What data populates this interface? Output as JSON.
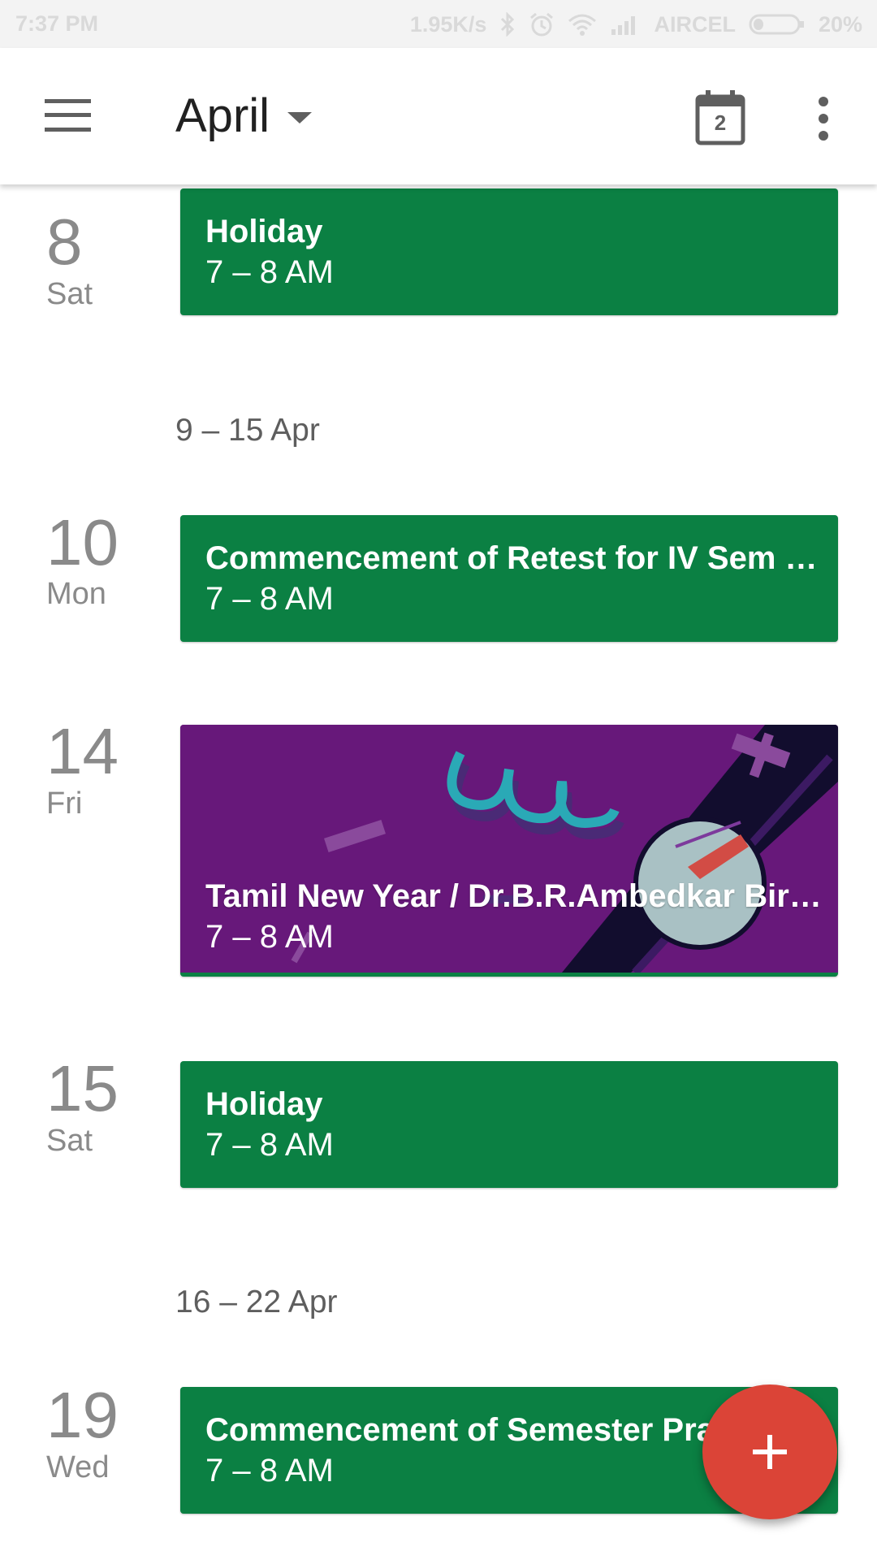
{
  "status_bar": {
    "time": "7:37 PM",
    "net_speed": "1.95K/s",
    "carrier": "AIRCEL",
    "battery": "20%",
    "icons": [
      "bluetooth-icon",
      "alarm-icon",
      "wifi-icon",
      "signal-icon",
      "battery-icon"
    ]
  },
  "app_bar": {
    "menu_icon": "menu-icon",
    "month": "April",
    "today_day": "2",
    "overflow_icon": "more-vert-icon"
  },
  "schedule": {
    "days": [
      {
        "day": "8",
        "weekday": "Sat",
        "event": {
          "title": "Holiday",
          "time": "7 – 8 AM"
        }
      },
      {
        "day": "10",
        "weekday": "Mon",
        "event": {
          "title": "Commencement of Retest for IV Sem B…",
          "time": "7 – 8 AM"
        }
      },
      {
        "day": "14",
        "weekday": "Fri",
        "event": {
          "title": "Tamil New Year /   Dr.B.R.Ambedkar Birt…",
          "time": "7 – 8 AM"
        }
      },
      {
        "day": "15",
        "weekday": "Sat",
        "event": {
          "title": "Holiday",
          "time": "7 – 8 AM"
        }
      },
      {
        "day": "19",
        "weekday": "Wed",
        "event": {
          "title": "Commencement of Semester Pra",
          "time": "7 – 8 AM"
        }
      }
    ],
    "weeks": [
      "9 – 15 Apr",
      "16 – 22 Apr"
    ]
  },
  "colors": {
    "event_green": "#0b8043",
    "illustration_purple": "#67187a",
    "fab_red": "#db4437"
  },
  "fab": {
    "icon": "plus-icon"
  }
}
